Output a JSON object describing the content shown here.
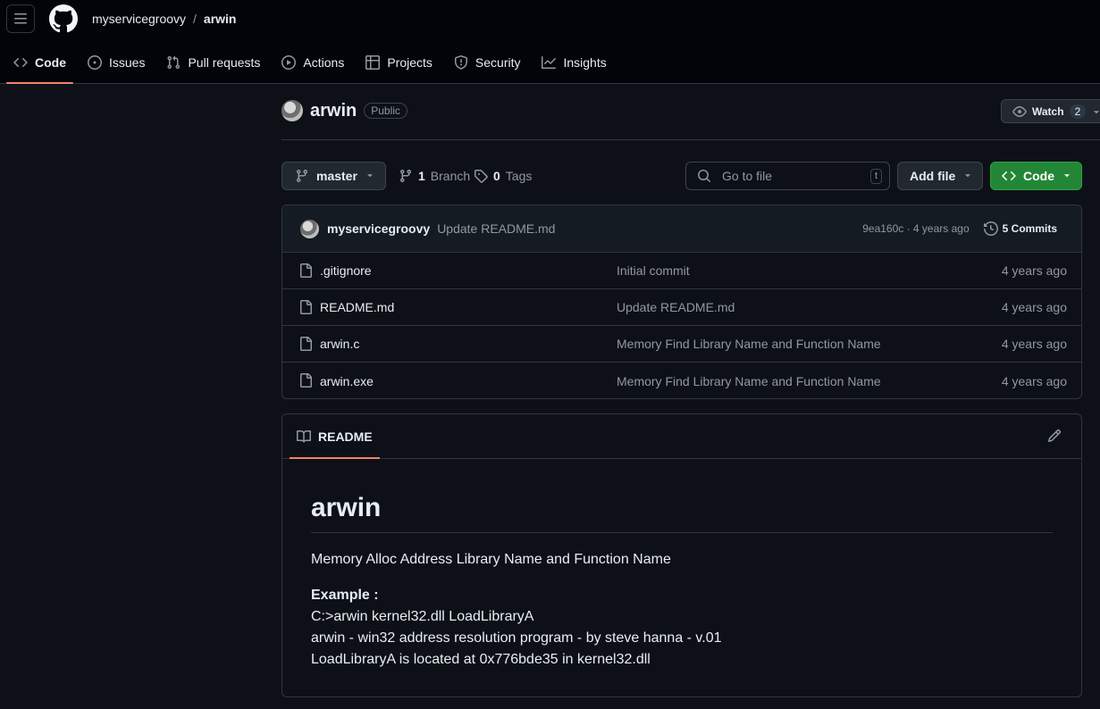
{
  "header": {
    "owner": "myservicegroovy",
    "separator": "/",
    "repo": "arwin"
  },
  "tabs": [
    {
      "label": "Code",
      "icon": "code-icon",
      "selected": true
    },
    {
      "label": "Issues",
      "icon": "issue-opened-icon"
    },
    {
      "label": "Pull requests",
      "icon": "git-pull-request-icon"
    },
    {
      "label": "Actions",
      "icon": "play-icon"
    },
    {
      "label": "Projects",
      "icon": "table-icon"
    },
    {
      "label": "Security",
      "icon": "shield-icon"
    },
    {
      "label": "Insights",
      "icon": "graph-icon"
    }
  ],
  "repo": {
    "name": "arwin",
    "visibility": "Public",
    "watch_label": "Watch",
    "watch_count": "2"
  },
  "branch_bar": {
    "branch": "master",
    "branch_count": "1",
    "branch_label": "Branch",
    "tag_count": "0",
    "tag_label": "Tags",
    "goto_placeholder": "Go to file",
    "goto_shortcut": "t",
    "add_file": "Add file",
    "code": "Code"
  },
  "latest_commit": {
    "author": "myservicegroovy",
    "message": "Update README.md",
    "hash_time": "9ea160c · 4 years ago",
    "commits": "5 Commits"
  },
  "files": [
    {
      "name": ".gitignore",
      "message": "Initial commit",
      "date": "4 years ago"
    },
    {
      "name": "README.md",
      "message": "Update README.md",
      "date": "4 years ago"
    },
    {
      "name": "arwin.c",
      "message": "Memory Find Library Name and Function Name",
      "date": "4 years ago"
    },
    {
      "name": "arwin.exe",
      "message": "Memory Find Library Name and Function Name",
      "date": "4 years ago"
    }
  ],
  "readme": {
    "tab_label": "README",
    "title": "arwin",
    "description": "Memory Alloc Address Library Name and Function Name",
    "example_label": "Example :",
    "example_lines": [
      "C:>arwin kernel32.dll LoadLibraryA",
      "arwin - win32 address resolution program - by steve hanna - v.01",
      "LoadLibraryA is located at 0x776bde35 in kernel32.dll"
    ]
  },
  "colors": {
    "background": "#0d1117",
    "header_bg": "#010409",
    "border": "#30363d",
    "accent_underline": "#f78166",
    "primary_button": "#238636",
    "muted_text": "#9198a1"
  }
}
